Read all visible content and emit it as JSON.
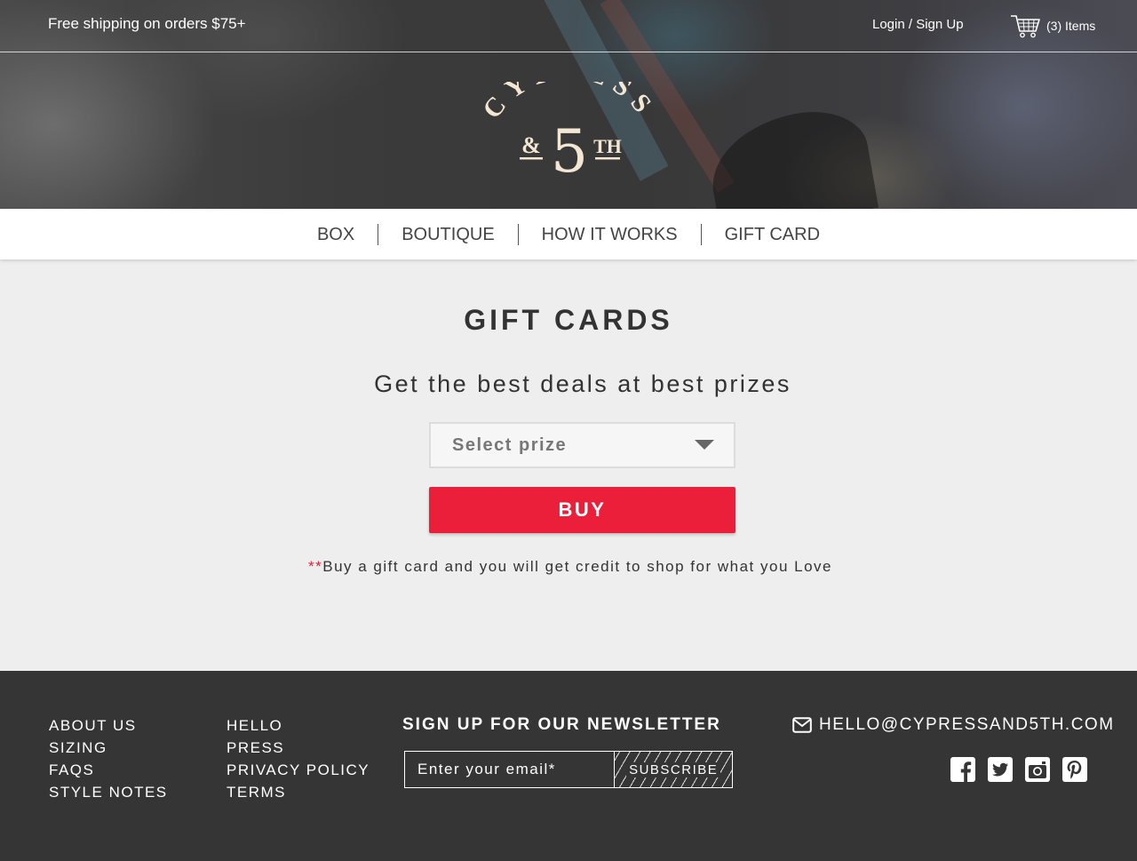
{
  "topbar": {
    "shipping": "Free shipping on orders $75+",
    "login": "Login / Sign Up",
    "cart": "(3) Items",
    "cart_icon": "shopping-cart-icon"
  },
  "logo": {
    "word": "CYPRESS",
    "amp": "&",
    "number": "5",
    "suffix": "TH",
    "color": "#f3e6d3"
  },
  "nav": {
    "items": [
      {
        "label": "BOX"
      },
      {
        "label": "BOUTIQUE"
      },
      {
        "label": "HOW IT WORKS"
      },
      {
        "label": "GIFT CARD"
      }
    ]
  },
  "main": {
    "title": "GIFT CARDS",
    "subtitle": "Get the best deals at best prizes",
    "select_label": "Select prize",
    "buy_label": "BUY",
    "note_stars": "**",
    "note": "Buy a gift card and you will get credit to shop for what you Love",
    "accent": "#ec1f3a"
  },
  "footer": {
    "col1": [
      {
        "label": "ABOUT US"
      },
      {
        "label": "SIZING"
      },
      {
        "label": "FAQS"
      },
      {
        "label": "STYLE NOTES"
      }
    ],
    "col2": [
      {
        "label": "HELLO"
      },
      {
        "label": "PRESS"
      },
      {
        "label": "PRIVACY POLICY"
      },
      {
        "label": "TERMS"
      }
    ],
    "newsletter_title": "SIGN UP FOR OUR NEWSLETTER",
    "email_placeholder": "Enter your email*",
    "subscribe_label": "SUBSCRIBE",
    "contact_email": "HELLO@CYPRESSAND5TH.COM",
    "socials": [
      "facebook-icon",
      "twitter-icon",
      "instagram-icon",
      "pinterest-icon"
    ],
    "background": "#353535"
  }
}
